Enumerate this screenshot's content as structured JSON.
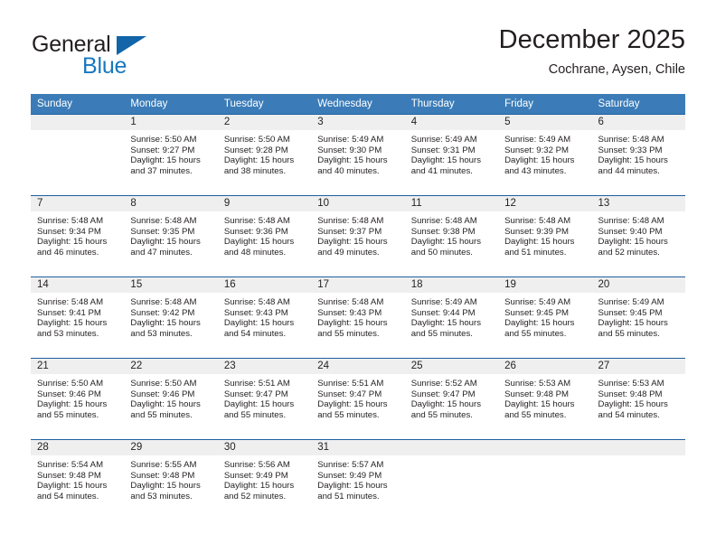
{
  "brand": {
    "name_top": "General",
    "name_bottom": "Blue"
  },
  "header": {
    "title": "December 2025",
    "subtitle": "Cochrane, Aysen, Chile"
  },
  "colors": {
    "header_blue": "#3b7cb8",
    "grid_blue": "#1f5fa0",
    "daynum_band": "#efefef",
    "logo_blue": "#1878be",
    "logo_triangle": "#1165a8",
    "text": "#231f20"
  },
  "weekdays": [
    "Sunday",
    "Monday",
    "Tuesday",
    "Wednesday",
    "Thursday",
    "Friday",
    "Saturday"
  ],
  "weeks": [
    [
      {
        "day": ""
      },
      {
        "day": "1",
        "sunrise": "Sunrise: 5:50 AM",
        "sunset": "Sunset: 9:27 PM",
        "daylight1": "Daylight: 15 hours",
        "daylight2": "and 37 minutes."
      },
      {
        "day": "2",
        "sunrise": "Sunrise: 5:50 AM",
        "sunset": "Sunset: 9:28 PM",
        "daylight1": "Daylight: 15 hours",
        "daylight2": "and 38 minutes."
      },
      {
        "day": "3",
        "sunrise": "Sunrise: 5:49 AM",
        "sunset": "Sunset: 9:30 PM",
        "daylight1": "Daylight: 15 hours",
        "daylight2": "and 40 minutes."
      },
      {
        "day": "4",
        "sunrise": "Sunrise: 5:49 AM",
        "sunset": "Sunset: 9:31 PM",
        "daylight1": "Daylight: 15 hours",
        "daylight2": "and 41 minutes."
      },
      {
        "day": "5",
        "sunrise": "Sunrise: 5:49 AM",
        "sunset": "Sunset: 9:32 PM",
        "daylight1": "Daylight: 15 hours",
        "daylight2": "and 43 minutes."
      },
      {
        "day": "6",
        "sunrise": "Sunrise: 5:48 AM",
        "sunset": "Sunset: 9:33 PM",
        "daylight1": "Daylight: 15 hours",
        "daylight2": "and 44 minutes."
      }
    ],
    [
      {
        "day": "7",
        "sunrise": "Sunrise: 5:48 AM",
        "sunset": "Sunset: 9:34 PM",
        "daylight1": "Daylight: 15 hours",
        "daylight2": "and 46 minutes."
      },
      {
        "day": "8",
        "sunrise": "Sunrise: 5:48 AM",
        "sunset": "Sunset: 9:35 PM",
        "daylight1": "Daylight: 15 hours",
        "daylight2": "and 47 minutes."
      },
      {
        "day": "9",
        "sunrise": "Sunrise: 5:48 AM",
        "sunset": "Sunset: 9:36 PM",
        "daylight1": "Daylight: 15 hours",
        "daylight2": "and 48 minutes."
      },
      {
        "day": "10",
        "sunrise": "Sunrise: 5:48 AM",
        "sunset": "Sunset: 9:37 PM",
        "daylight1": "Daylight: 15 hours",
        "daylight2": "and 49 minutes."
      },
      {
        "day": "11",
        "sunrise": "Sunrise: 5:48 AM",
        "sunset": "Sunset: 9:38 PM",
        "daylight1": "Daylight: 15 hours",
        "daylight2": "and 50 minutes."
      },
      {
        "day": "12",
        "sunrise": "Sunrise: 5:48 AM",
        "sunset": "Sunset: 9:39 PM",
        "daylight1": "Daylight: 15 hours",
        "daylight2": "and 51 minutes."
      },
      {
        "day": "13",
        "sunrise": "Sunrise: 5:48 AM",
        "sunset": "Sunset: 9:40 PM",
        "daylight1": "Daylight: 15 hours",
        "daylight2": "and 52 minutes."
      }
    ],
    [
      {
        "day": "14",
        "sunrise": "Sunrise: 5:48 AM",
        "sunset": "Sunset: 9:41 PM",
        "daylight1": "Daylight: 15 hours",
        "daylight2": "and 53 minutes."
      },
      {
        "day": "15",
        "sunrise": "Sunrise: 5:48 AM",
        "sunset": "Sunset: 9:42 PM",
        "daylight1": "Daylight: 15 hours",
        "daylight2": "and 53 minutes."
      },
      {
        "day": "16",
        "sunrise": "Sunrise: 5:48 AM",
        "sunset": "Sunset: 9:43 PM",
        "daylight1": "Daylight: 15 hours",
        "daylight2": "and 54 minutes."
      },
      {
        "day": "17",
        "sunrise": "Sunrise: 5:48 AM",
        "sunset": "Sunset: 9:43 PM",
        "daylight1": "Daylight: 15 hours",
        "daylight2": "and 55 minutes."
      },
      {
        "day": "18",
        "sunrise": "Sunrise: 5:49 AM",
        "sunset": "Sunset: 9:44 PM",
        "daylight1": "Daylight: 15 hours",
        "daylight2": "and 55 minutes."
      },
      {
        "day": "19",
        "sunrise": "Sunrise: 5:49 AM",
        "sunset": "Sunset: 9:45 PM",
        "daylight1": "Daylight: 15 hours",
        "daylight2": "and 55 minutes."
      },
      {
        "day": "20",
        "sunrise": "Sunrise: 5:49 AM",
        "sunset": "Sunset: 9:45 PM",
        "daylight1": "Daylight: 15 hours",
        "daylight2": "and 55 minutes."
      }
    ],
    [
      {
        "day": "21",
        "sunrise": "Sunrise: 5:50 AM",
        "sunset": "Sunset: 9:46 PM",
        "daylight1": "Daylight: 15 hours",
        "daylight2": "and 55 minutes."
      },
      {
        "day": "22",
        "sunrise": "Sunrise: 5:50 AM",
        "sunset": "Sunset: 9:46 PM",
        "daylight1": "Daylight: 15 hours",
        "daylight2": "and 55 minutes."
      },
      {
        "day": "23",
        "sunrise": "Sunrise: 5:51 AM",
        "sunset": "Sunset: 9:47 PM",
        "daylight1": "Daylight: 15 hours",
        "daylight2": "and 55 minutes."
      },
      {
        "day": "24",
        "sunrise": "Sunrise: 5:51 AM",
        "sunset": "Sunset: 9:47 PM",
        "daylight1": "Daylight: 15 hours",
        "daylight2": "and 55 minutes."
      },
      {
        "day": "25",
        "sunrise": "Sunrise: 5:52 AM",
        "sunset": "Sunset: 9:47 PM",
        "daylight1": "Daylight: 15 hours",
        "daylight2": "and 55 minutes."
      },
      {
        "day": "26",
        "sunrise": "Sunrise: 5:53 AM",
        "sunset": "Sunset: 9:48 PM",
        "daylight1": "Daylight: 15 hours",
        "daylight2": "and 55 minutes."
      },
      {
        "day": "27",
        "sunrise": "Sunrise: 5:53 AM",
        "sunset": "Sunset: 9:48 PM",
        "daylight1": "Daylight: 15 hours",
        "daylight2": "and 54 minutes."
      }
    ],
    [
      {
        "day": "28",
        "sunrise": "Sunrise: 5:54 AM",
        "sunset": "Sunset: 9:48 PM",
        "daylight1": "Daylight: 15 hours",
        "daylight2": "and 54 minutes."
      },
      {
        "day": "29",
        "sunrise": "Sunrise: 5:55 AM",
        "sunset": "Sunset: 9:48 PM",
        "daylight1": "Daylight: 15 hours",
        "daylight2": "and 53 minutes."
      },
      {
        "day": "30",
        "sunrise": "Sunrise: 5:56 AM",
        "sunset": "Sunset: 9:49 PM",
        "daylight1": "Daylight: 15 hours",
        "daylight2": "and 52 minutes."
      },
      {
        "day": "31",
        "sunrise": "Sunrise: 5:57 AM",
        "sunset": "Sunset: 9:49 PM",
        "daylight1": "Daylight: 15 hours",
        "daylight2": "and 51 minutes."
      },
      {
        "day": ""
      },
      {
        "day": ""
      },
      {
        "day": ""
      }
    ]
  ]
}
